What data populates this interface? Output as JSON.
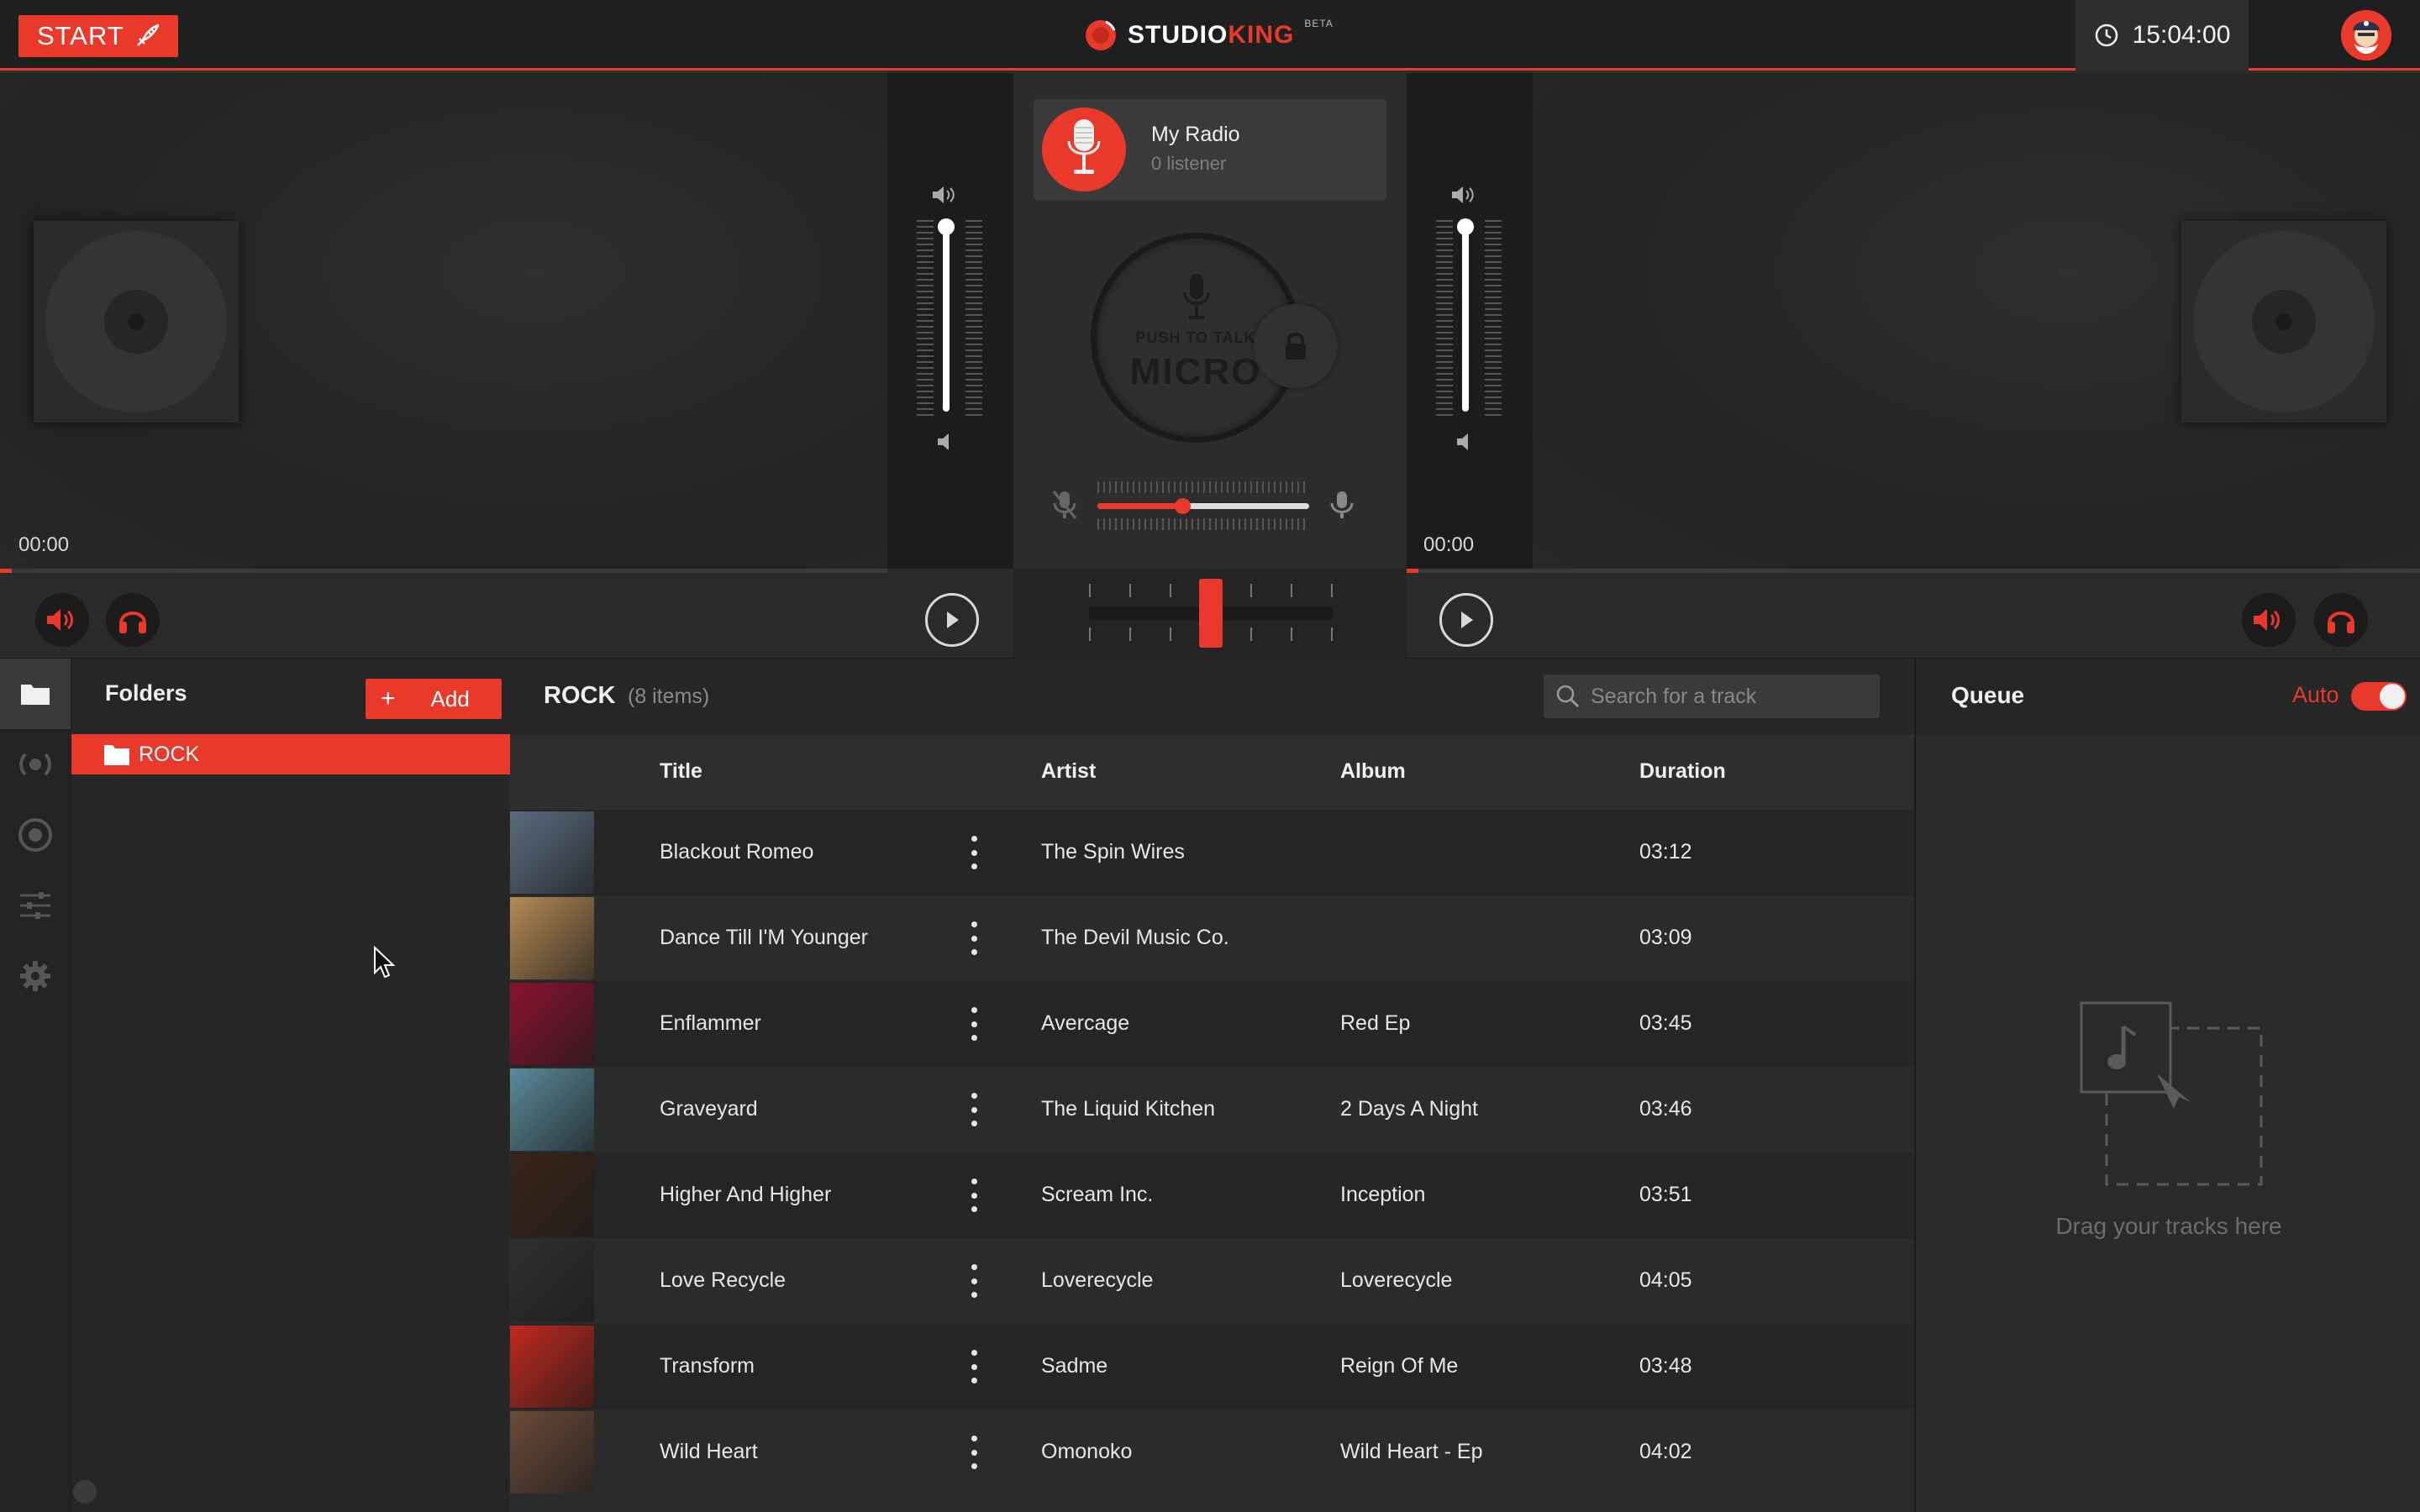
{
  "topbar": {
    "start_label": "START",
    "logo_studio": "STUDIO",
    "logo_king": "KING",
    "logo_beta": "BETA",
    "clock": "15:04:00"
  },
  "decks": {
    "left_time": "00:00",
    "right_time": "00:00",
    "left_progress": 0,
    "right_progress": 0
  },
  "radio": {
    "name": "My Radio",
    "listeners": "0 listener"
  },
  "micro": {
    "push_to_talk": "PUSH TO TALK",
    "label": "MICRO",
    "level_percent": 40
  },
  "crossfader": {
    "position_percent": 50
  },
  "folders": {
    "title": "Folders",
    "add_label": "Add",
    "items": [
      {
        "label": "ROCK"
      }
    ]
  },
  "tracks": {
    "title": "ROCK",
    "count": "(8 items)",
    "search_placeholder": "Search for a track",
    "columns": {
      "title": "Title",
      "artist": "Artist",
      "album": "Album",
      "duration": "Duration"
    },
    "rows": [
      {
        "title": "Blackout Romeo",
        "artist": "The Spin Wires",
        "album": "",
        "duration": "03:12",
        "cover": "#5a6c80"
      },
      {
        "title": "Dance Till I'M Younger",
        "artist": "The Devil Music Co.",
        "album": "",
        "duration": "03:09",
        "cover": "#b48a55"
      },
      {
        "title": "Enflammer",
        "artist": "Avercage",
        "album": "Red Ep",
        "duration": "03:45",
        "cover": "#8a1230"
      },
      {
        "title": "Graveyard",
        "artist": "The Liquid Kitchen",
        "album": "2 Days A Night",
        "duration": "03:46",
        "cover": "#5a8a9a"
      },
      {
        "title": "Higher And Higher",
        "artist": "Scream Inc.",
        "album": "Inception",
        "duration": "03:51",
        "cover": "#3a2418"
      },
      {
        "title": "Love Recycle",
        "artist": "Loverecycle",
        "album": "Loverecycle",
        "duration": "04:05",
        "cover": "#303030"
      },
      {
        "title": "Transform",
        "artist": "Sadme",
        "album": "Reign Of Me",
        "duration": "03:48",
        "cover": "#c0281e"
      },
      {
        "title": "Wild Heart",
        "artist": "Omonoko",
        "album": "Wild Heart - Ep",
        "duration": "04:02",
        "cover": "#6a4a38"
      }
    ]
  },
  "queue": {
    "title": "Queue",
    "auto_label": "Auto",
    "auto_enabled": true,
    "empty_text": "Drag your tracks here"
  },
  "colors": {
    "accent": "#e8392b",
    "background": "#2b2b2b"
  }
}
